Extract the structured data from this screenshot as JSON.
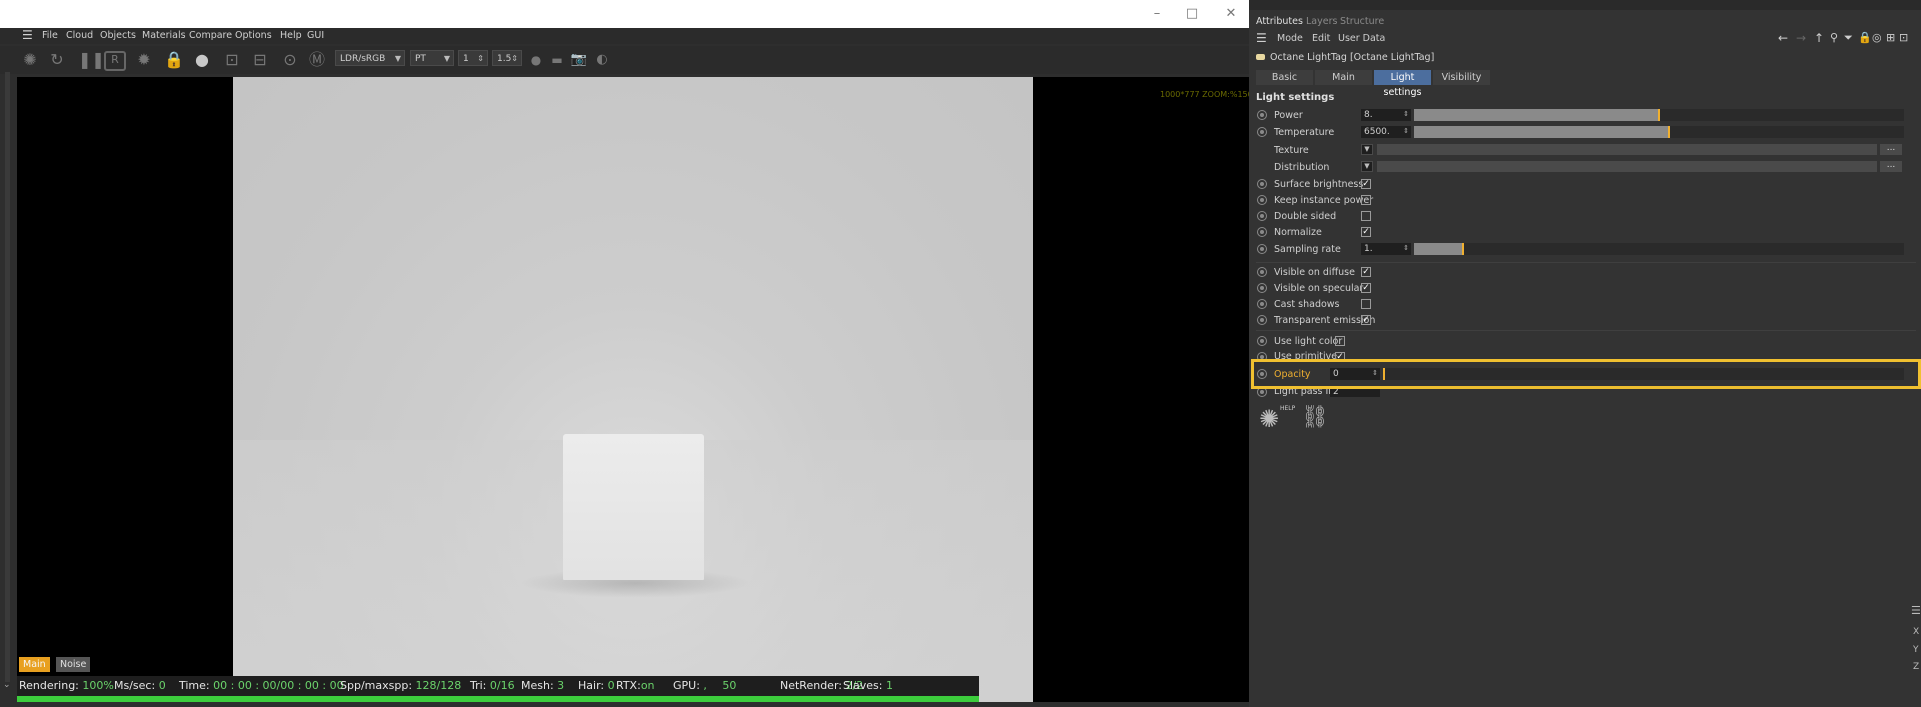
{
  "viewer": {
    "window_controls": {
      "minimize": "–",
      "maximize": "□",
      "close": "✕"
    },
    "menu": [
      "File",
      "Cloud",
      "Objects",
      "Materials",
      "Compare",
      "Options",
      "Help",
      "GUI"
    ],
    "toolbar": {
      "colorspace": "LDR/sRGB",
      "kernel": "PT",
      "value1": "1",
      "value2": "1.5"
    },
    "zoom_info": "1000*777 ZOOM:%150",
    "pass_tabs": [
      "Main",
      "Noise"
    ],
    "status": {
      "rendering_label": "Rendering:",
      "rendering": "100%",
      "mssec_label": "Ms/sec:",
      "mssec": "0",
      "time_label": "Time:",
      "time": "00 : 00 : 00/00 : 00 : 00",
      "spp_label": "Spp/maxspp:",
      "spp": "128/128",
      "tri_label": "Tri:",
      "tri": "0/16",
      "mesh_label": "Mesh:",
      "mesh": "3",
      "hair_label": "Hair:",
      "hair": "0",
      "rtx_label": "RTX:",
      "rtx": "on",
      "gpu_label": "GPU:",
      "gpu_a": ",",
      "gpu_b": "50",
      "netrender_label": "NetRender:",
      "netrender": "2/2",
      "slaves_label": "Slaves:",
      "slaves": "1"
    },
    "progress": 1.0
  },
  "attributes": {
    "tabs": [
      "Attributes",
      "Layers",
      "Structure"
    ],
    "menu": [
      "Mode",
      "Edit",
      "User Data"
    ],
    "object_name": "Octane LightTag [Octane LightTag]",
    "section_tabs": [
      "Basic",
      "Main",
      "Light settings",
      "Visibility"
    ],
    "active_section_tab": "Light settings",
    "section_title": "Light settings",
    "params": {
      "power": {
        "label": "Power",
        "value": "8.",
        "fraction": 0.5
      },
      "temperature": {
        "label": "Temperature",
        "value": "6500.",
        "fraction": 0.52
      },
      "texture": {
        "label": "Texture",
        "button": "..."
      },
      "distribution": {
        "label": "Distribution",
        "button": "..."
      },
      "surface_brightness": {
        "label": "Surface brightness",
        "checked": true
      },
      "keep_instance_power": {
        "label": "Keep instance power",
        "checked": false
      },
      "double_sided": {
        "label": "Double sided",
        "checked": false
      },
      "normalize": {
        "label": "Normalize",
        "checked": true
      },
      "sampling_rate": {
        "label": "Sampling rate",
        "value": "1.",
        "fraction": 0.1
      },
      "visible_on_diffuse": {
        "label": "Visible on diffuse",
        "checked": true
      },
      "visible_on_specular": {
        "label": "Visible on specular",
        "checked": true
      },
      "cast_shadows": {
        "label": "Cast shadows",
        "checked": false
      },
      "transparent_emission": {
        "label": "Transparent emission",
        "checked": true
      },
      "use_light_color": {
        "label": "Use light color",
        "checked": false
      },
      "use_primitive": {
        "label": "Use primitive",
        "checked": true
      },
      "opacity": {
        "label": "Opacity",
        "value": "0",
        "fraction": 0.0
      },
      "light_pass_id": {
        "label": "Light pass ID",
        "value": "2"
      }
    },
    "side_letters": [
      "X",
      "Y",
      "Z"
    ],
    "colors": {
      "highlight": "#f0c030",
      "active_tab": "#4c6e9e",
      "accent": "#f0b030"
    }
  }
}
